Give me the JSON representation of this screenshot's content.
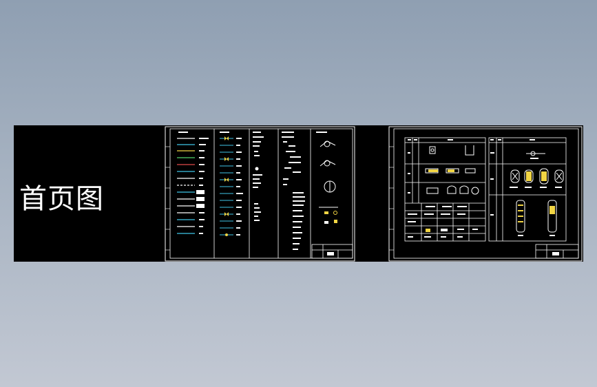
{
  "title_label": "首页图",
  "colors": {
    "background_top": "#8f9fb2",
    "background_bottom": "#c2c8d3",
    "canvas": "#000000",
    "line": "#ffffff",
    "accent_yellow": "#f2d544",
    "accent_cyan": "#3fc6e8",
    "accent_red": "#e14b4b",
    "accent_green": "#52d36b"
  }
}
